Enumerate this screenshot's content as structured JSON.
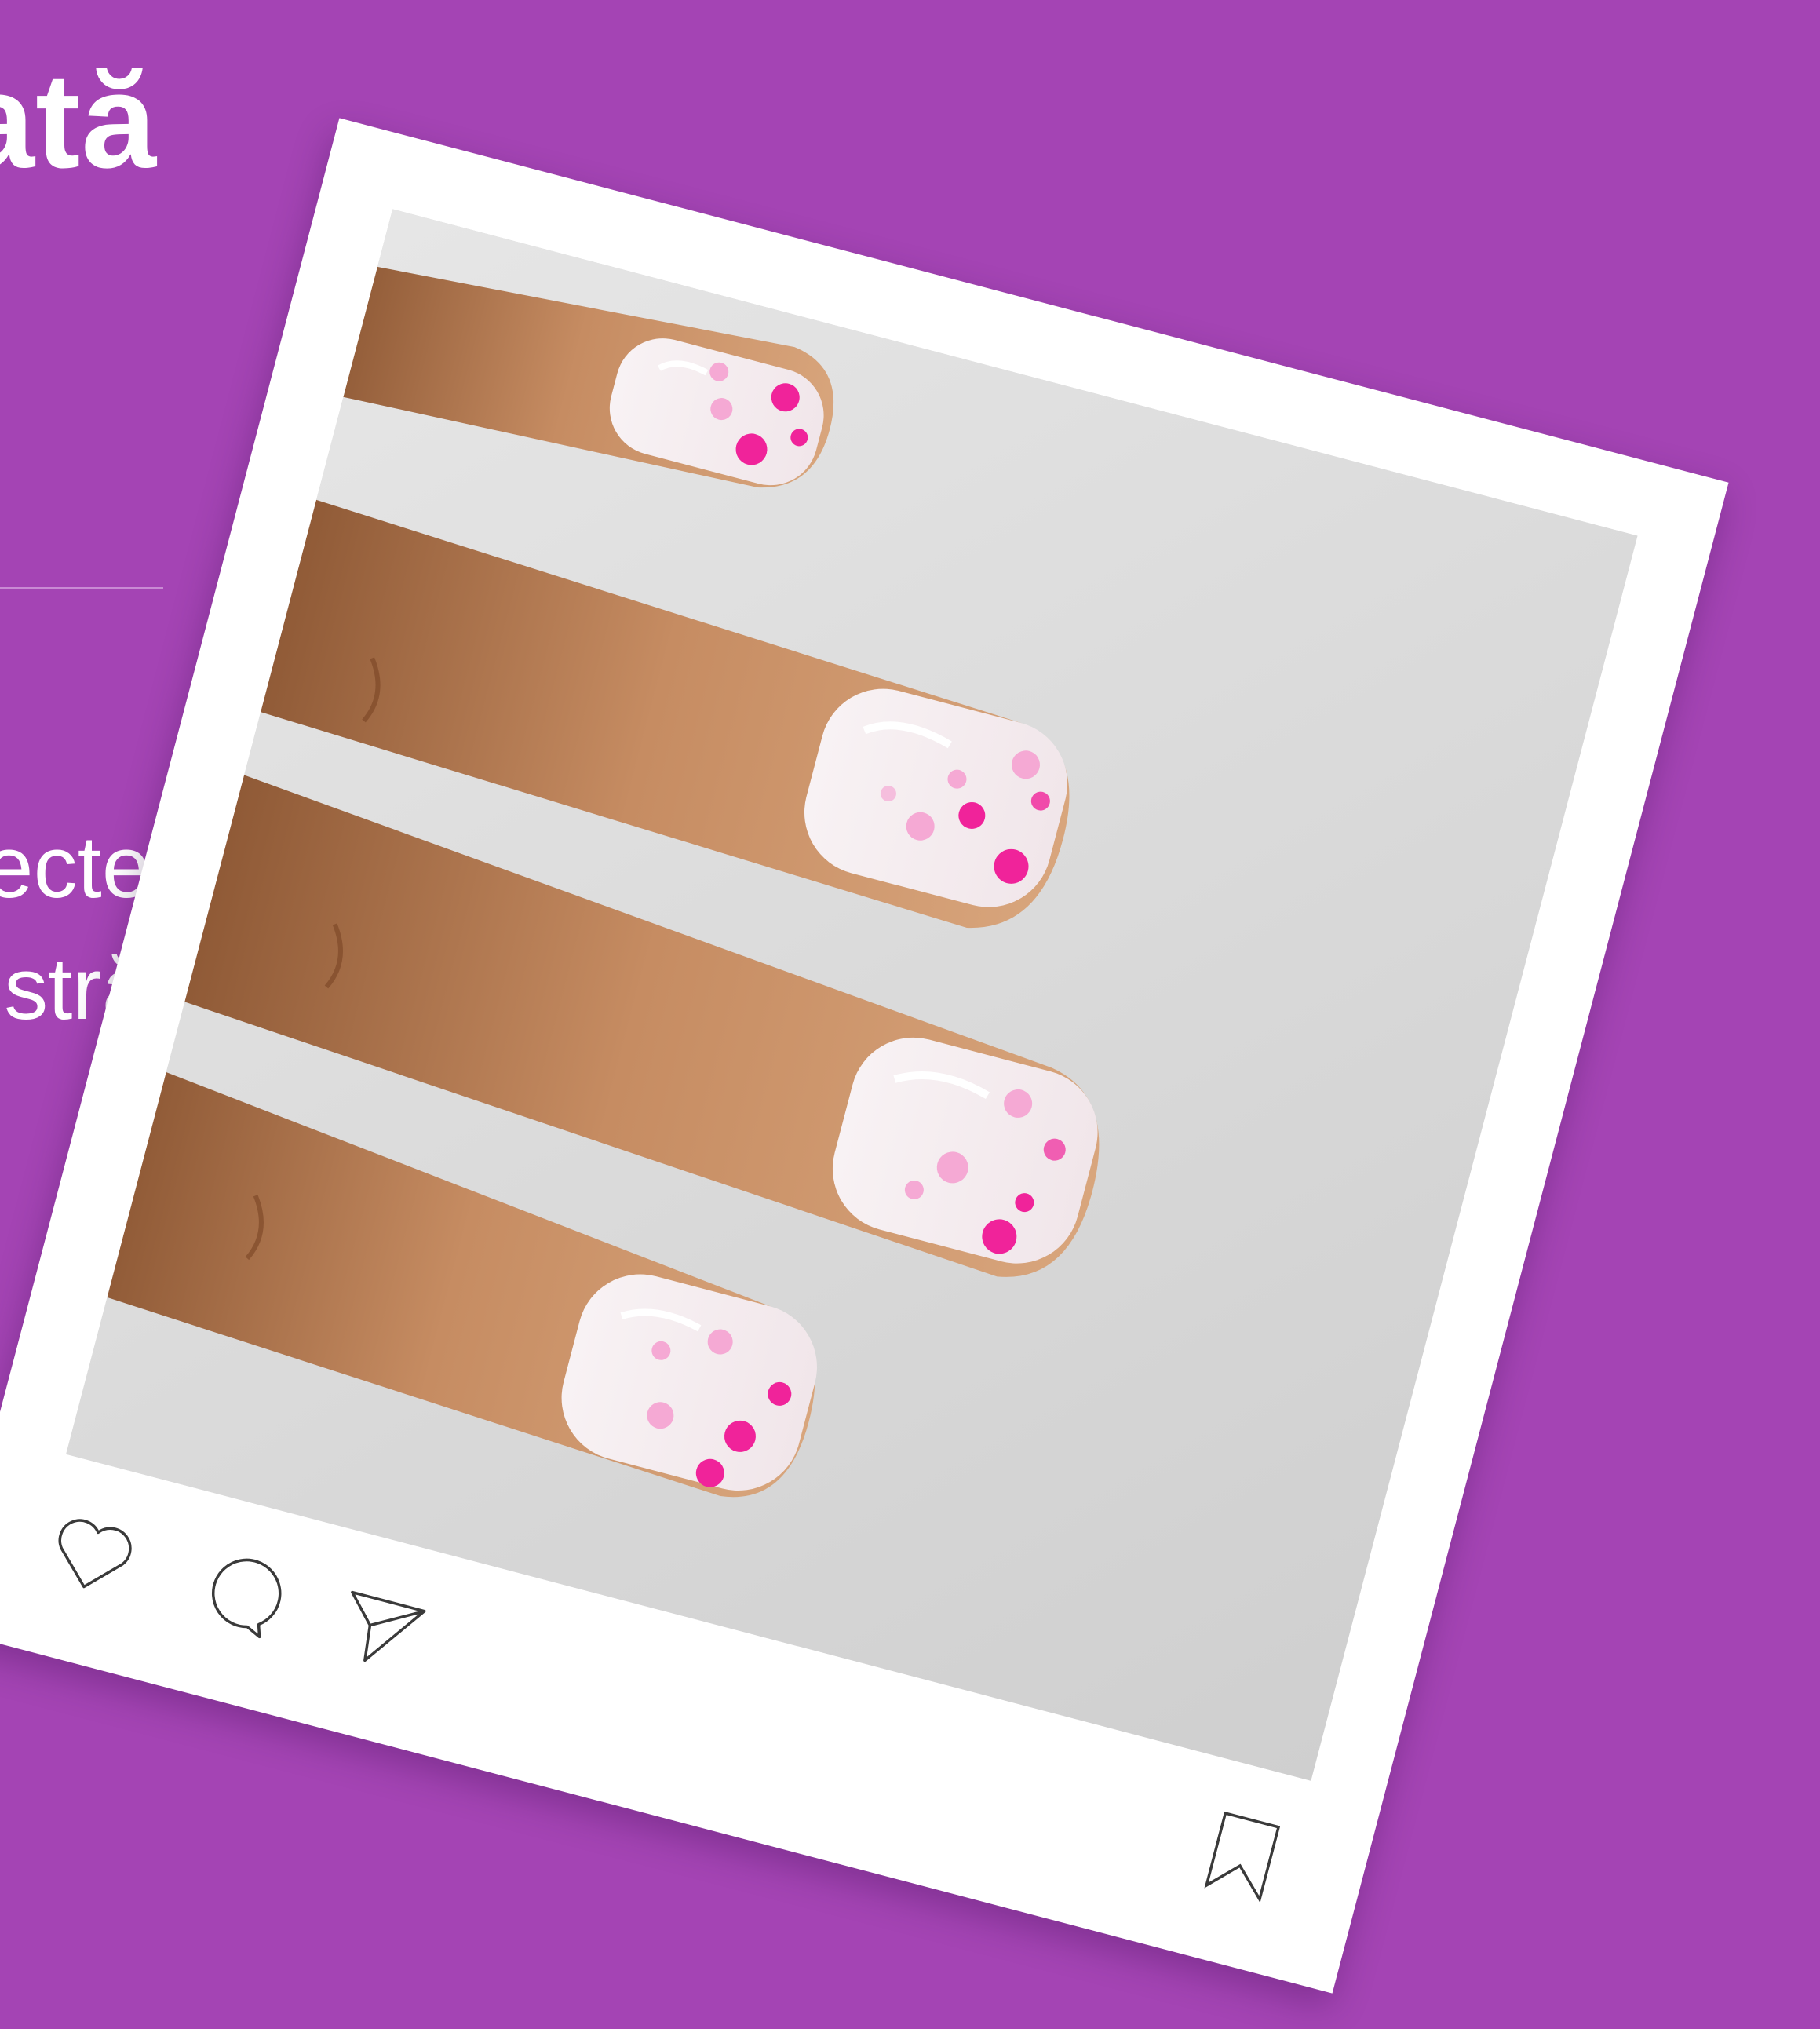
{
  "colors": {
    "background": "#a444b4",
    "card": "#ffffff",
    "text": "#ffffff",
    "divider": "#c98ad4",
    "icon_stroke": "#3a3a3a",
    "nail_white": "#f4eef0",
    "dot_hot_pink": "#f0239a",
    "dot_light_pink": "#f5a9d4",
    "skin": "#c98e63",
    "photo_background": "#d9d9d9"
  },
  "text_column": {
    "heading_fragment": "ată",
    "body_line_1": "ecte",
    "body_line_2": "stră"
  },
  "post": {
    "photo_subject": "nail-art-photo",
    "icons": {
      "like": "heart-outline-icon",
      "comment": "speech-bubble-outline-icon",
      "share": "paper-plane-outline-icon",
      "save": "bookmark-outline-icon"
    }
  }
}
